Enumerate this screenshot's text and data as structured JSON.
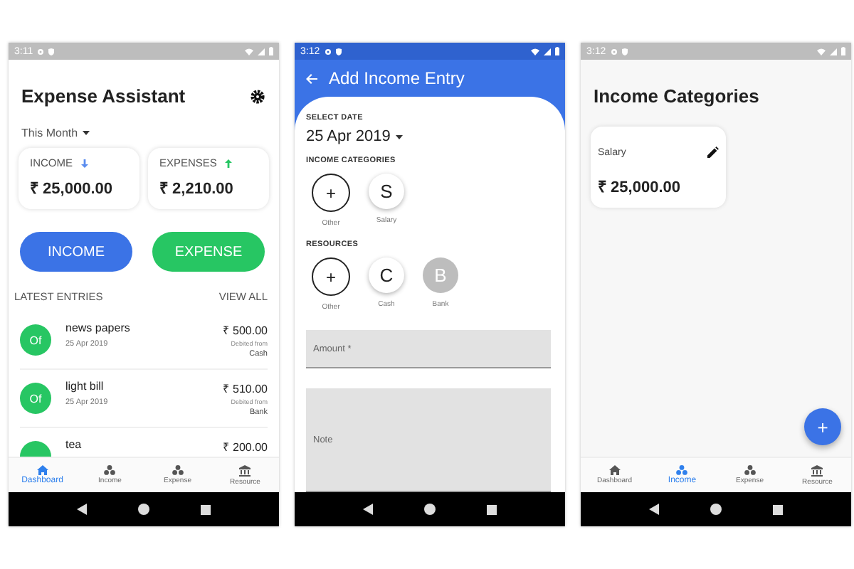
{
  "screens": [
    {
      "kind": "dashboard",
      "status_time": "3:11",
      "title": "Expense Assistant",
      "period": "This Month",
      "summary": [
        {
          "kind": "income",
          "label": "INCOME",
          "amount": "₹ 25,000.00"
        },
        {
          "kind": "expense",
          "label": "EXPENSES",
          "amount": "₹ 2,210.00"
        }
      ],
      "buttons": [
        {
          "kind": "income",
          "label": "INCOME"
        },
        {
          "kind": "expense",
          "label": "EXPENSE"
        }
      ],
      "section": "LATEST ENTRIES",
      "view_all": "VIEW ALL",
      "entries": [
        {
          "initials": "Of",
          "title": "news papers",
          "date": "25 Apr 2019",
          "amount": "₹ 500.00",
          "note": "Debited from",
          "source": "Cash"
        },
        {
          "initials": "Of",
          "title": "light bill",
          "date": "25 Apr 2019",
          "amount": "₹ 510.00",
          "note": "Debited from",
          "source": "Bank"
        },
        {
          "title": "tea",
          "amount": "₹ 200.00"
        }
      ],
      "tabs": [
        {
          "kind": "home",
          "label": "Dashboard",
          "selected": true
        },
        {
          "kind": "circles",
          "label": "Income",
          "selected": false
        },
        {
          "kind": "circles",
          "label": "Expense",
          "selected": false
        },
        {
          "kind": "bank",
          "label": "Resource",
          "selected": false
        }
      ]
    },
    {
      "kind": "form",
      "status_time": "3:12",
      "title": "Add Income Entry",
      "date_label": "SELECT DATE",
      "date": "25 Apr 2019",
      "groups": [
        {
          "heading": "INCOME CATEGORIES",
          "options": [
            {
              "kind": "add",
              "symbol": "+",
              "label": "Other",
              "selected": false
            },
            {
              "kind": "letter",
              "symbol": "S",
              "label": "Salary",
              "selected": false
            }
          ]
        },
        {
          "heading": "RESOURCES",
          "options": [
            {
              "kind": "add",
              "symbol": "+",
              "label": "Other",
              "selected": false
            },
            {
              "kind": "letter",
              "symbol": "C",
              "label": "Cash",
              "selected": false
            },
            {
              "kind": "letter",
              "symbol": "B",
              "label": "Bank",
              "selected": true
            }
          ]
        }
      ],
      "fields": [
        {
          "kind": "line",
          "placeholder": "Amount *"
        },
        {
          "kind": "multiline",
          "placeholder": "Note"
        }
      ]
    },
    {
      "kind": "categories",
      "status_time": "3:12",
      "title": "Income Categories",
      "cards": [
        {
          "name": "Salary",
          "amount": "₹ 25,000.00"
        }
      ],
      "fab": "+",
      "tabs": [
        {
          "kind": "home",
          "label": "Dashboard",
          "selected": false
        },
        {
          "kind": "circles",
          "label": "Income",
          "selected": true
        },
        {
          "kind": "circles",
          "label": "Expense",
          "selected": false
        },
        {
          "kind": "bank",
          "label": "Resource",
          "selected": false
        }
      ]
    }
  ]
}
